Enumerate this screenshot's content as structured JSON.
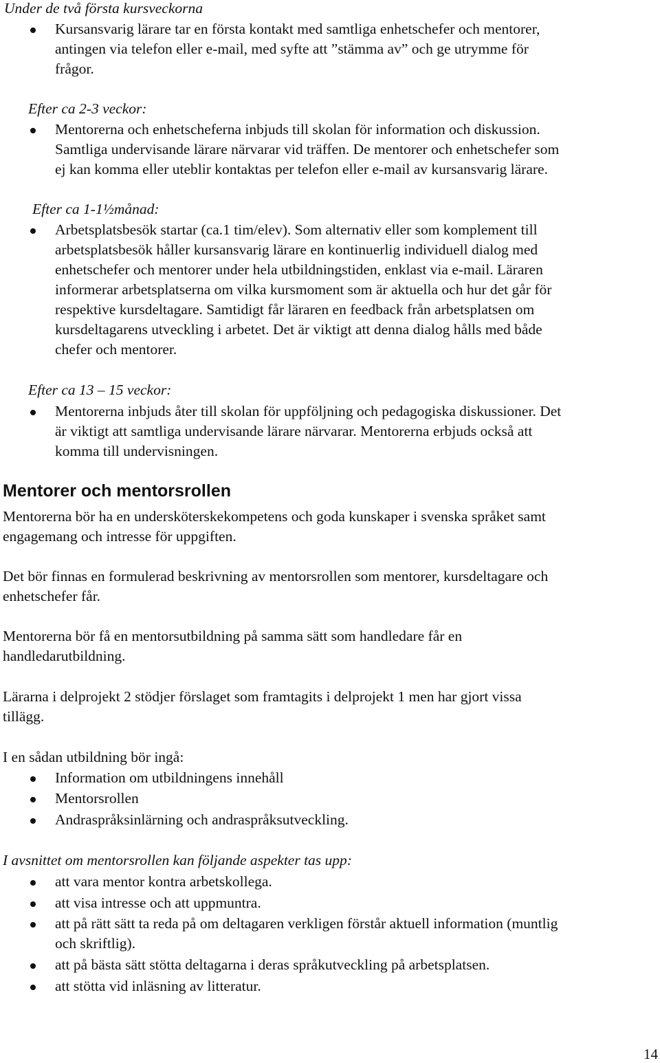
{
  "document": {
    "sections": [
      {
        "heading": "Under de två första kursveckorna",
        "bullets": [
          [
            "Kursansvarig lärare tar en första kontakt med samtliga enhetschefer och mentorer,",
            "antingen via telefon eller e-mail, med syfte att ”stämma av” och ge utrymme för",
            "frågor."
          ]
        ]
      },
      {
        "heading": "Efter ca 2-3 veckor:",
        "bullets": [
          [
            "Mentorerna och enhetscheferna inbjuds till skolan för information och diskussion.",
            "Samtliga undervisande lärare närvarar vid träffen. De mentorer och enhetschefer som",
            "ej kan komma eller uteblir kontaktas per telefon eller e-mail av kursansvarig lärare."
          ]
        ]
      },
      {
        "heading": "Efter ca 1-1½månad:",
        "bullets": [
          [
            "Arbetsplatsbesök startar (ca.1 tim/elev). Som alternativ eller som komplement till",
            "arbetsplatsbesök håller kursansvarig lärare en kontinuerlig individuell dialog med",
            "enhetschefer och mentorer under hela utbildningstiden, enklast via e-mail. Läraren",
            "informerar arbetsplatserna om vilka kursmoment som är aktuella och hur det går för",
            "respektive kursdeltagare. Samtidigt får läraren en feedback från arbetsplatsen om",
            "kursdeltagarens utveckling i arbetet. Det är viktigt att denna dialog hålls med både",
            "chefer och mentorer."
          ]
        ]
      },
      {
        "heading": "Efter ca 13 – 15 veckor:",
        "bullets": [
          [
            "Mentorerna inbjuds åter till skolan för uppföljning och pedagogiska diskussioner. Det",
            "är viktigt att samtliga undervisande lärare närvarar. Mentorerna erbjuds också att",
            "komma till undervisningen."
          ]
        ]
      }
    ],
    "main_heading": "Mentorer och mentorsrollen",
    "paragraphs": [
      [
        "Mentorerna bör ha en undersköterskekompetens och goda kunskaper i svenska språket samt",
        "engagemang och intresse för uppgiften."
      ],
      [
        "Det bör finnas en formulerad beskrivning av mentorsrollen som mentorer, kursdeltagare och",
        "enhetschefer får."
      ],
      [
        "Mentorerna bör få en mentorsutbildning på samma sätt som handledare får en",
        "handledarutbildning."
      ],
      [
        "Lärarna i delprojekt 2 stödjer förslaget som framtagits i delprojekt 1 men har gjort vissa",
        "tillägg."
      ]
    ],
    "training_intro": "I en sådan utbildning bör ingå:",
    "training_items": [
      "Information om utbildningens innehåll",
      "Mentorsrollen",
      "Andraspråksinlärning och andraspråksutveckling."
    ],
    "aspects_intro": "I avsnittet om mentorsrollen kan följande aspekter tas upp:",
    "aspects_items": [
      [
        "att vara mentor kontra arbetskollega."
      ],
      [
        "att visa intresse och att uppmuntra."
      ],
      [
        "att på rätt sätt ta reda på om deltagaren verkligen förstår aktuell information (muntlig",
        "och skriftlig)."
      ],
      [
        "att på bästa sätt stötta deltagarna i deras språkutveckling på arbetsplatsen."
      ],
      [
        "att stötta vid inläsning av litteratur."
      ]
    ],
    "page_number": "14"
  }
}
